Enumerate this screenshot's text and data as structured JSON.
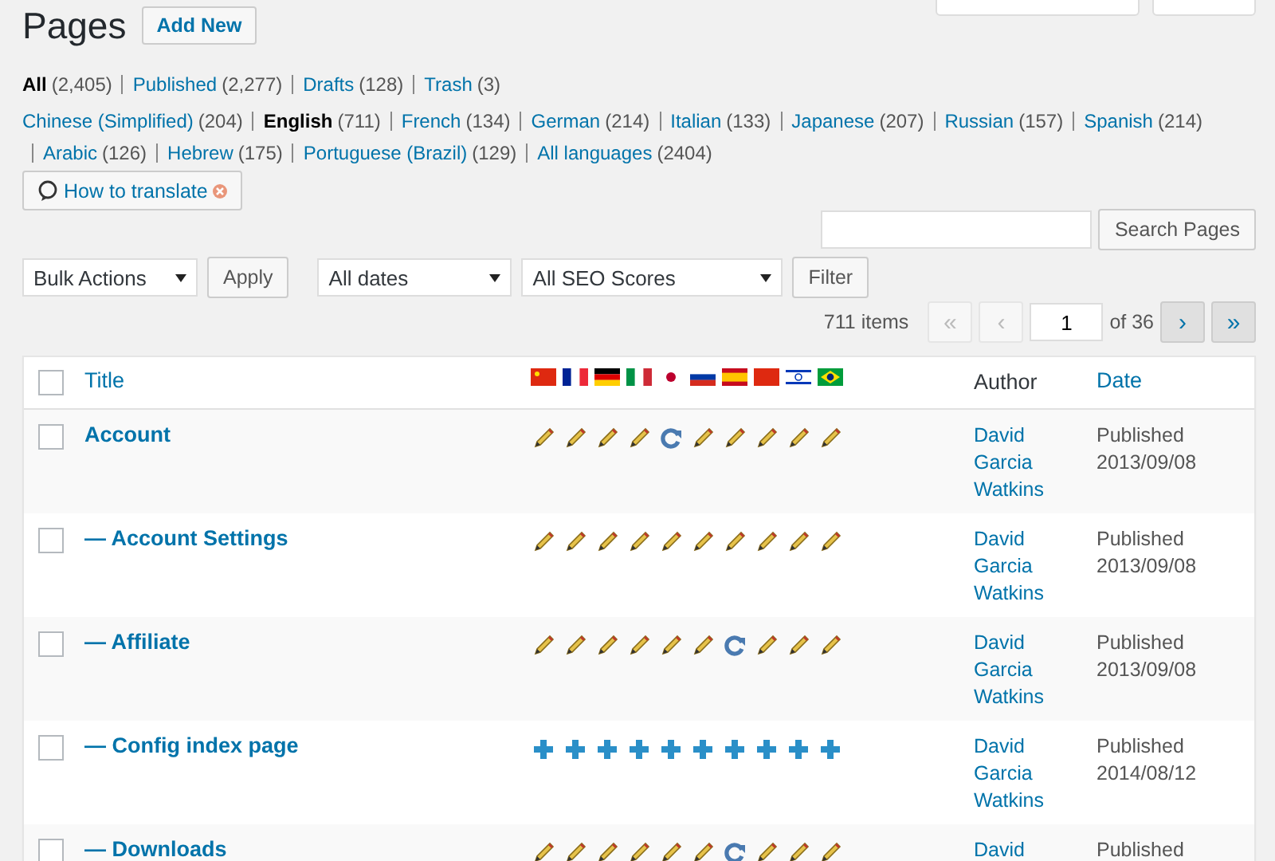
{
  "header": {
    "title": "Pages",
    "add_button": "Add New",
    "top_buttons": [
      {
        "kind": "screen-options"
      },
      {
        "kind": "help"
      }
    ]
  },
  "status_filters": [
    {
      "label": "All",
      "count": "(2,405)",
      "selected": true
    },
    {
      "label": "Published",
      "count": "(2,277)",
      "selected": false
    },
    {
      "label": "Drafts",
      "count": "(128)",
      "selected": false
    },
    {
      "label": "Trash",
      "count": "(3)",
      "selected": false
    }
  ],
  "language_filters": [
    {
      "label": "Chinese (Simplified)",
      "count": "(204)",
      "selected": false
    },
    {
      "label": "English",
      "count": "(711)",
      "selected": true
    },
    {
      "label": "French",
      "count": "(134)",
      "selected": false
    },
    {
      "label": "German",
      "count": "(214)",
      "selected": false
    },
    {
      "label": "Italian",
      "count": "(133)",
      "selected": false
    },
    {
      "label": "Japanese",
      "count": "(207)",
      "selected": false
    },
    {
      "label": "Russian",
      "count": "(157)",
      "selected": false
    },
    {
      "label": "Spanish",
      "count": "(214)",
      "selected": false
    },
    {
      "label": "Arabic",
      "count": "(126)",
      "selected": false
    },
    {
      "label": "Hebrew",
      "count": "(175)",
      "selected": false
    },
    {
      "label": "Portuguese (Brazil)",
      "count": "(129)",
      "selected": false
    },
    {
      "label": "All languages",
      "count": "(2404)",
      "selected": false
    }
  ],
  "help_button": "How to translate",
  "search": {
    "button": "Search Pages"
  },
  "filters": {
    "bulk_actions": "Bulk Actions",
    "apply": "Apply",
    "dates": "All dates",
    "seo": "All SEO Scores",
    "filter": "Filter"
  },
  "pagination": {
    "items": "711 items",
    "first": "«",
    "prev": "‹",
    "page": "1",
    "of": "of 36",
    "next": "›",
    "last": "»",
    "first_disabled": true,
    "prev_disabled": true
  },
  "table": {
    "select_all_checked": false,
    "columns": {
      "title": "Title",
      "author": "Author",
      "date": "Date"
    },
    "rows": [
      {
        "title": "Account",
        "translations": [
          {
            "kind": "edit"
          },
          {
            "kind": "edit"
          },
          {
            "kind": "edit"
          },
          {
            "kind": "edit"
          },
          {
            "kind": "update"
          },
          {
            "kind": "edit"
          },
          {
            "kind": "edit"
          },
          {
            "kind": "edit"
          },
          {
            "kind": "edit"
          },
          {
            "kind": "edit"
          }
        ],
        "author": "David Garcia Watkins",
        "status": "Published",
        "date": "2013/09/08",
        "checked": false
      },
      {
        "title": "— Account Settings",
        "translations": [
          {
            "kind": "edit"
          },
          {
            "kind": "edit"
          },
          {
            "kind": "edit"
          },
          {
            "kind": "edit"
          },
          {
            "kind": "edit"
          },
          {
            "kind": "edit"
          },
          {
            "kind": "edit"
          },
          {
            "kind": "edit"
          },
          {
            "kind": "edit"
          },
          {
            "kind": "edit"
          }
        ],
        "author": "David Garcia Watkins",
        "status": "Published",
        "date": "2013/09/08",
        "checked": false
      },
      {
        "title": "— Affiliate",
        "translations": [
          {
            "kind": "edit"
          },
          {
            "kind": "edit"
          },
          {
            "kind": "edit"
          },
          {
            "kind": "edit"
          },
          {
            "kind": "edit"
          },
          {
            "kind": "edit"
          },
          {
            "kind": "update"
          },
          {
            "kind": "edit"
          },
          {
            "kind": "edit"
          },
          {
            "kind": "edit"
          }
        ],
        "author": "David Garcia Watkins",
        "status": "Published",
        "date": "2013/09/08",
        "checked": false
      },
      {
        "title": "— Config index page",
        "translations": [
          {
            "kind": "add"
          },
          {
            "kind": "add"
          },
          {
            "kind": "add"
          },
          {
            "kind": "add"
          },
          {
            "kind": "add"
          },
          {
            "kind": "add"
          },
          {
            "kind": "add"
          },
          {
            "kind": "add"
          },
          {
            "kind": "add"
          },
          {
            "kind": "add"
          }
        ],
        "author": "David Garcia Watkins",
        "status": "Published",
        "date": "2014/08/12",
        "checked": false
      },
      {
        "title": "— Downloads",
        "translations": [
          {
            "kind": "edit"
          },
          {
            "kind": "edit"
          },
          {
            "kind": "edit"
          },
          {
            "kind": "edit"
          },
          {
            "kind": "edit"
          },
          {
            "kind": "edit"
          },
          {
            "kind": "update"
          },
          {
            "kind": "edit"
          },
          {
            "kind": "edit"
          },
          {
            "kind": "edit"
          }
        ],
        "author": "David",
        "status": "Published",
        "checked": false
      }
    ]
  }
}
